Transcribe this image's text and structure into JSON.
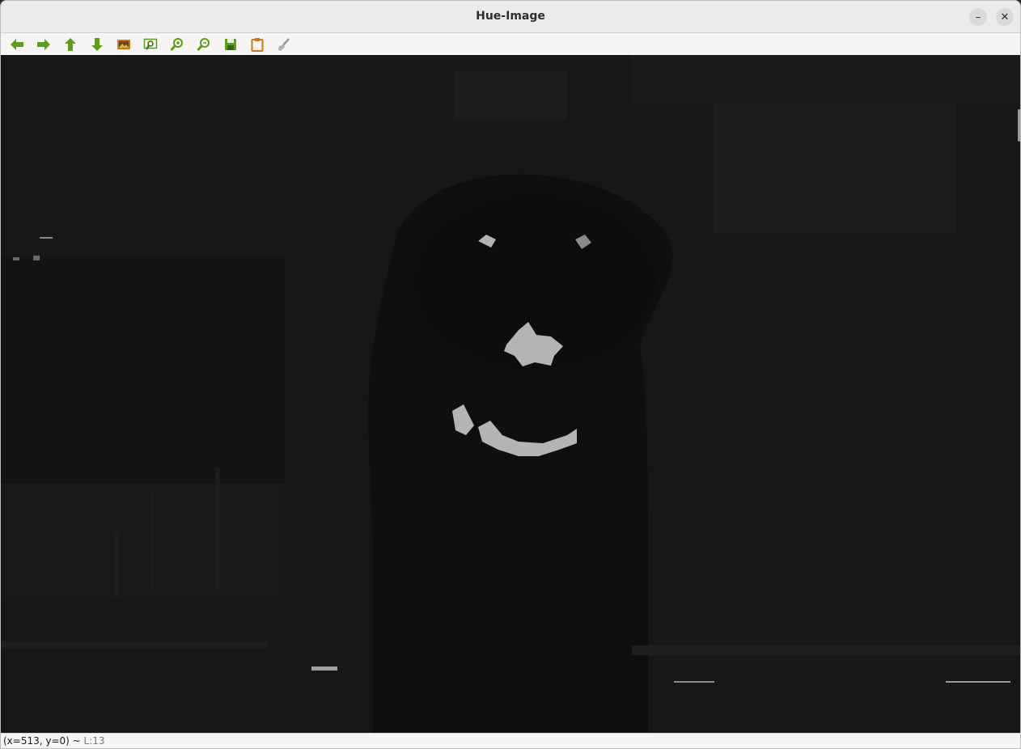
{
  "window": {
    "title": "Hue-Image"
  },
  "toolbar": {
    "buttons": [
      {
        "name": "back-button",
        "icon": "arrow-left-icon"
      },
      {
        "name": "forward-button",
        "icon": "arrow-right-icon"
      },
      {
        "name": "up-button",
        "icon": "arrow-up-icon"
      },
      {
        "name": "down-button",
        "icon": "arrow-down-icon"
      },
      {
        "name": "fit-image-button",
        "icon": "image-icon"
      },
      {
        "name": "zoom-area-button",
        "icon": "zoom-rect-icon"
      },
      {
        "name": "zoom-in-button",
        "icon": "zoom-in-icon"
      },
      {
        "name": "zoom-out-button",
        "icon": "zoom-out-icon"
      },
      {
        "name": "save-button",
        "icon": "floppy-icon"
      },
      {
        "name": "copy-button",
        "icon": "clipboard-icon"
      },
      {
        "name": "clear-button",
        "icon": "brush-icon"
      }
    ]
  },
  "status": {
    "coords": "(x=513, y=0) ~",
    "level": "L:13"
  },
  "colors": {
    "icon_green": "#5a9e1c",
    "icon_orange": "#c8781c",
    "image_background": "#161616",
    "highlight": "#b4b4b4"
  }
}
